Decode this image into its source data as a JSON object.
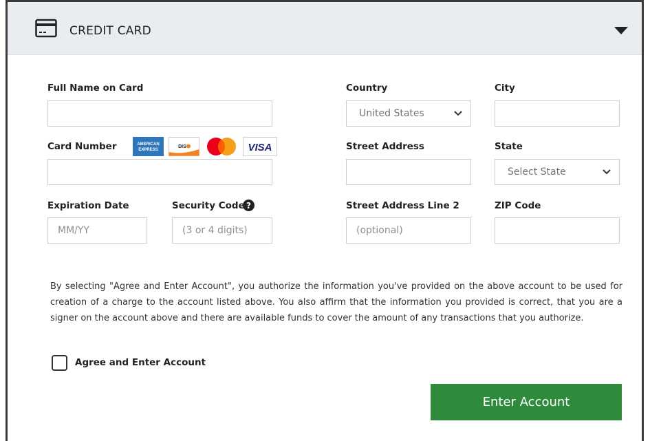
{
  "header": {
    "title": "CREDIT CARD"
  },
  "fields": {
    "full_name": {
      "label": "Full Name on Card",
      "value": ""
    },
    "card_number": {
      "label": "Card Number",
      "value": ""
    },
    "expiration": {
      "label": "Expiration Date",
      "placeholder": "MM/YY"
    },
    "security_code": {
      "label": "Security Code",
      "placeholder": "(3 or 4 digits)"
    },
    "country": {
      "label": "Country",
      "value": "United States"
    },
    "city": {
      "label": "City",
      "value": ""
    },
    "street": {
      "label": "Street Address",
      "value": ""
    },
    "state": {
      "label": "State",
      "value": "Select State"
    },
    "street2": {
      "label": "Street Address Line 2",
      "placeholder": "(optional)"
    },
    "zip": {
      "label": "ZIP Code",
      "value": ""
    }
  },
  "card_logos": {
    "amex": "AMERICAN EXPRESS",
    "discover": "DISCOVER",
    "visa": "VISA"
  },
  "legal_text": "By selecting \"Agree and Enter Account\", you authorize the information you've provided on the above account to be used for creation of a charge to the account listed above. You also affirm that the information you provided is correct, that you are a signer on the account above and there are available funds to cover the amount of any transactions that you authorize.",
  "agree_label": "Agree and Enter Account",
  "submit_label": "Enter Account",
  "colors": {
    "button_bg": "#2e8b3c",
    "header_bg": "#e9edf2",
    "amex": "#2e77bc",
    "visa_text": "#1a1f71",
    "mc_red": "#eb001b",
    "mc_orange": "#f79e1b"
  }
}
